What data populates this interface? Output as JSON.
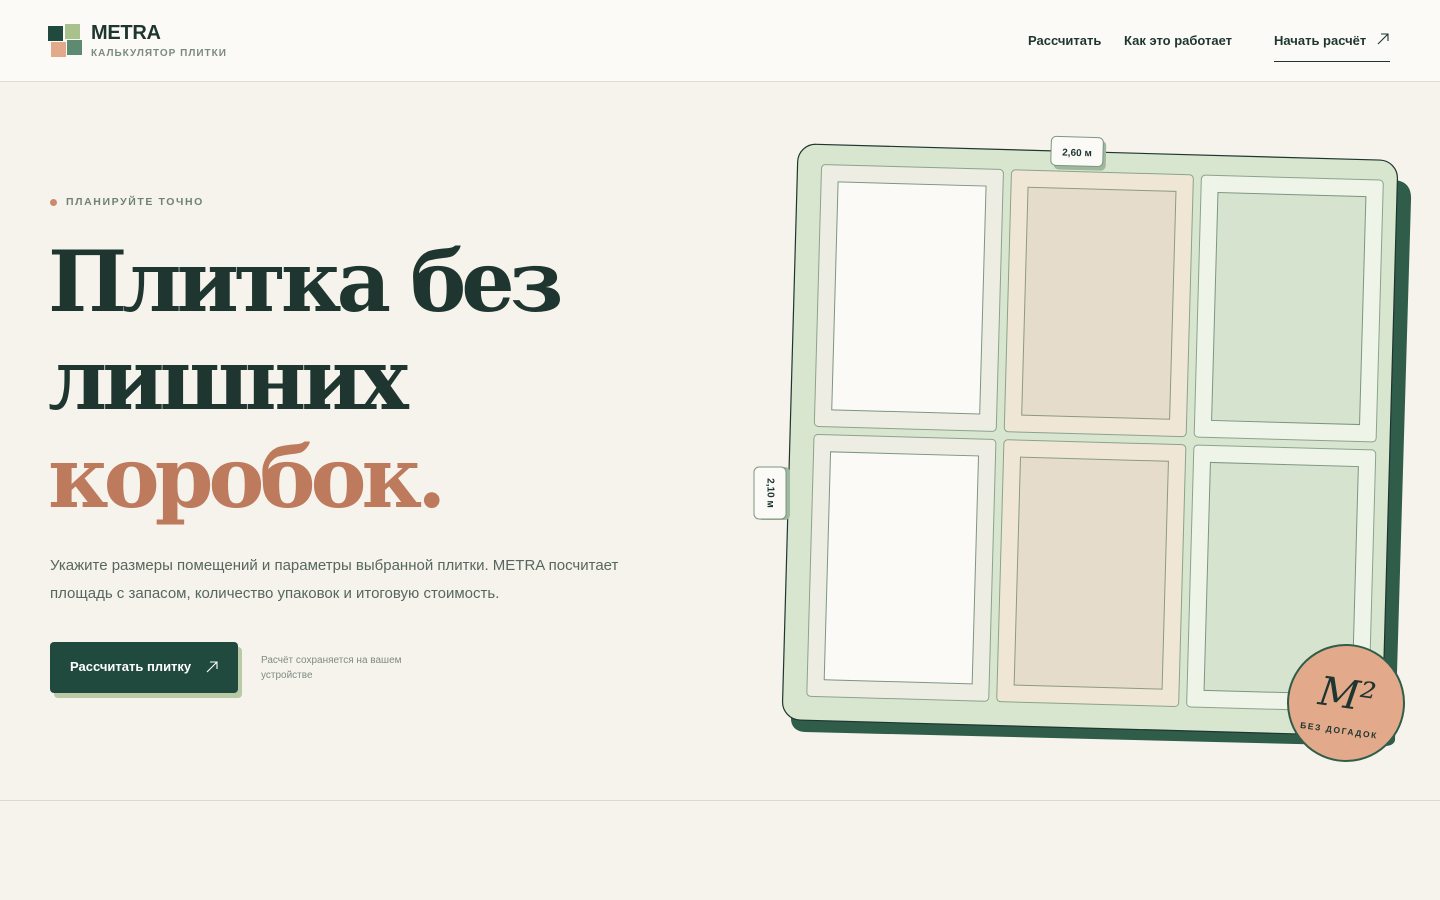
{
  "header": {
    "brand": "METRA",
    "tagline": "КАЛЬКУЛЯТОР ПЛИТКИ",
    "nav": [
      {
        "label": "Рассчитать"
      },
      {
        "label": "Как это работает"
      }
    ],
    "cta_label": "Начать расчёт",
    "logo_colors": [
      "#214a3f",
      "#a9c28d",
      "#e2a98a",
      "#5d8a70"
    ]
  },
  "hero": {
    "eyebrow": "ПЛАНИРУЙТЕ ТОЧНО",
    "title_line1": "Плитка без",
    "title_line2": "лишних",
    "title_line3": "коробок.",
    "lead": "Укажите размеры помещений и параметры выбранной плитки. METRA посчитает площадь с запасом, количество упаковок и итоговую стоимость.",
    "cta_label": "Рассчитать плитку",
    "note": "Расчёт сохраняется на вашем устройстве"
  },
  "illustration": {
    "width_label": "2,60 м",
    "height_label": "2,10 м",
    "badge_main": "M²",
    "badge_sub": "БЕЗ ДОГАДОК",
    "colors": {
      "board": "#d9e6cf",
      "board_shadow": "#2f5d4a",
      "tile_light": "#fbfaf6",
      "tile_sand": "#e5dccb",
      "tile_sage": "#d6e4cf",
      "badge": "#e2a98a",
      "accent": "#bd7a5d",
      "ink": "#1e3530"
    }
  }
}
